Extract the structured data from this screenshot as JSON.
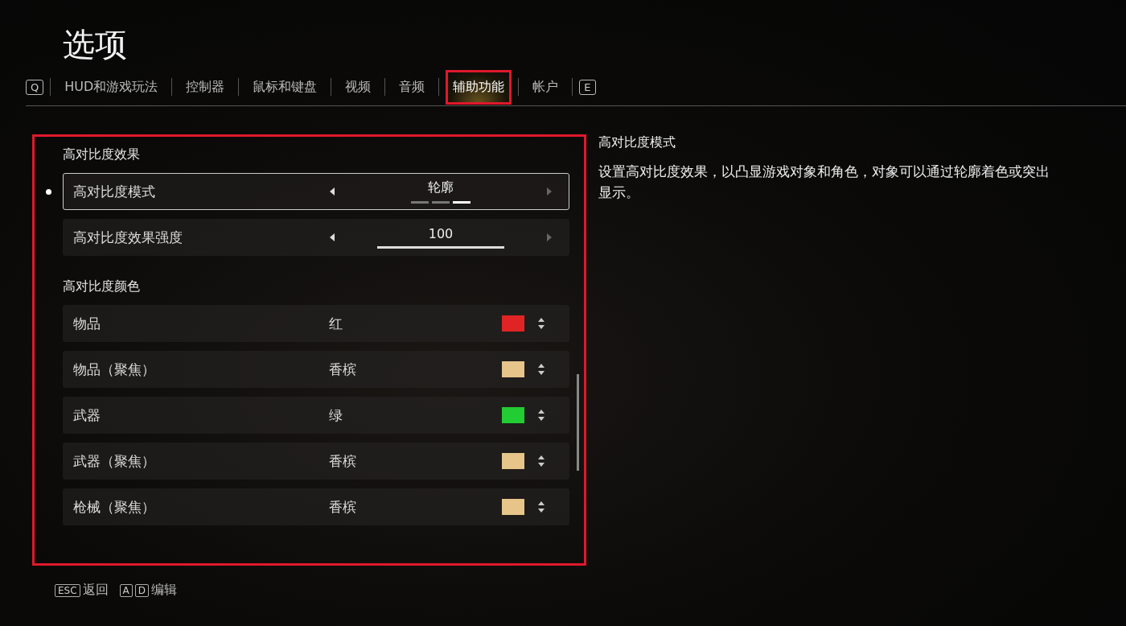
{
  "title": "选项",
  "tabs": [
    {
      "label": "Q",
      "kind": "key",
      "selected": false
    },
    {
      "label": "HUD和游戏玩法",
      "kind": "tab",
      "selected": false,
      "highlighted": false
    },
    {
      "label": "控制器",
      "kind": "tab",
      "selected": false,
      "highlighted": false
    },
    {
      "label": "鼠标和键盘",
      "kind": "tab",
      "selected": false,
      "highlighted": false
    },
    {
      "label": "视频",
      "kind": "tab",
      "selected": false,
      "highlighted": false
    },
    {
      "label": "音频",
      "kind": "tab",
      "selected": false,
      "highlighted": false
    },
    {
      "label": "辅助功能",
      "kind": "tab",
      "selected": true,
      "highlighted": true
    },
    {
      "label": "帐户",
      "kind": "tab",
      "selected": false,
      "highlighted": false
    },
    {
      "label": "E",
      "kind": "key",
      "selected": false
    }
  ],
  "panel": {
    "highlighted": true,
    "sections": [
      {
        "heading": "高对比度效果",
        "rows": [
          {
            "kind": "option",
            "label": "高对比度模式",
            "value": "轮廓",
            "selected": true,
            "steps": [
              {
                "selected": false
              },
              {
                "selected": false
              },
              {
                "selected": true
              }
            ]
          },
          {
            "kind": "slider",
            "label": "高对比度效果强度",
            "value": "100",
            "selected": false,
            "level": 1
          }
        ]
      },
      {
        "heading": "高对比度颜色",
        "rows": [
          {
            "kind": "color",
            "label": "物品",
            "value": "红",
            "selected": false,
            "color": "#e02424"
          },
          {
            "kind": "color",
            "label": "物品（聚焦）",
            "value": "香槟",
            "selected": false,
            "color": "#e6c48a"
          },
          {
            "kind": "color",
            "label": "武器",
            "value": "绿",
            "selected": false,
            "color": "#22cc33"
          },
          {
            "kind": "color",
            "label": "武器（聚焦）",
            "value": "香槟",
            "selected": false,
            "color": "#e6c48a"
          },
          {
            "kind": "color",
            "label": "枪械（聚焦）",
            "value": "香槟",
            "selected": false,
            "color": "#e6c48a"
          }
        ]
      }
    ]
  },
  "description": {
    "title": "高对比度模式",
    "text": "设置高对比度效果，以凸显游戏对象和角色，对象可以通过轮廓着色或突出显示。"
  },
  "hints": [
    {
      "keys": [
        "ESC"
      ],
      "label": "返回"
    },
    {
      "keys": [
        "A",
        "D"
      ],
      "label": "编辑"
    }
  ]
}
